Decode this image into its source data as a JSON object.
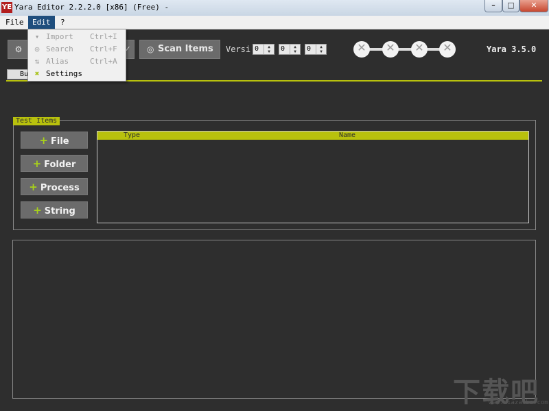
{
  "window": {
    "title": "Yara Editor 2.2.2.0 [x86] (Free) -",
    "app_icon": "YE",
    "controls": {
      "minimize": "–",
      "maximize": "□",
      "close": "✕"
    }
  },
  "menubar": {
    "items": [
      {
        "label": "File"
      },
      {
        "label": "Edit"
      },
      {
        "label": "?"
      }
    ]
  },
  "edit_menu": {
    "items": [
      {
        "label": "Import",
        "shortcut": "Ctrl+I",
        "icon": "chevron-down-icon",
        "enabled": false
      },
      {
        "label": "Search",
        "shortcut": "Ctrl+F",
        "icon": "search-icon",
        "enabled": false
      },
      {
        "label": "Alias",
        "shortcut": "Ctrl+A",
        "icon": "swap-icon",
        "enabled": false
      },
      {
        "label": "Settings",
        "shortcut": "",
        "icon": "tools-icon",
        "enabled": true
      }
    ]
  },
  "toolbar": {
    "scan_label": "Scan Items",
    "version_label": "Versi",
    "version_fields": [
      "0",
      "0",
      "0"
    ],
    "yara_version": "Yara 3.5.0"
  },
  "tabs": {
    "first_label": "Bu"
  },
  "test_items": {
    "group_label": "Test Items",
    "buttons": [
      "File",
      "Folder",
      "Process",
      "String"
    ],
    "columns": [
      "Type",
      "Name"
    ]
  },
  "watermark": {
    "main": "下载吧",
    "sub": "www.xiazaiba.com"
  },
  "colors": {
    "accent": "#b8c10d",
    "background": "#2e2e2e",
    "menu_active": "#1f4e7d"
  }
}
